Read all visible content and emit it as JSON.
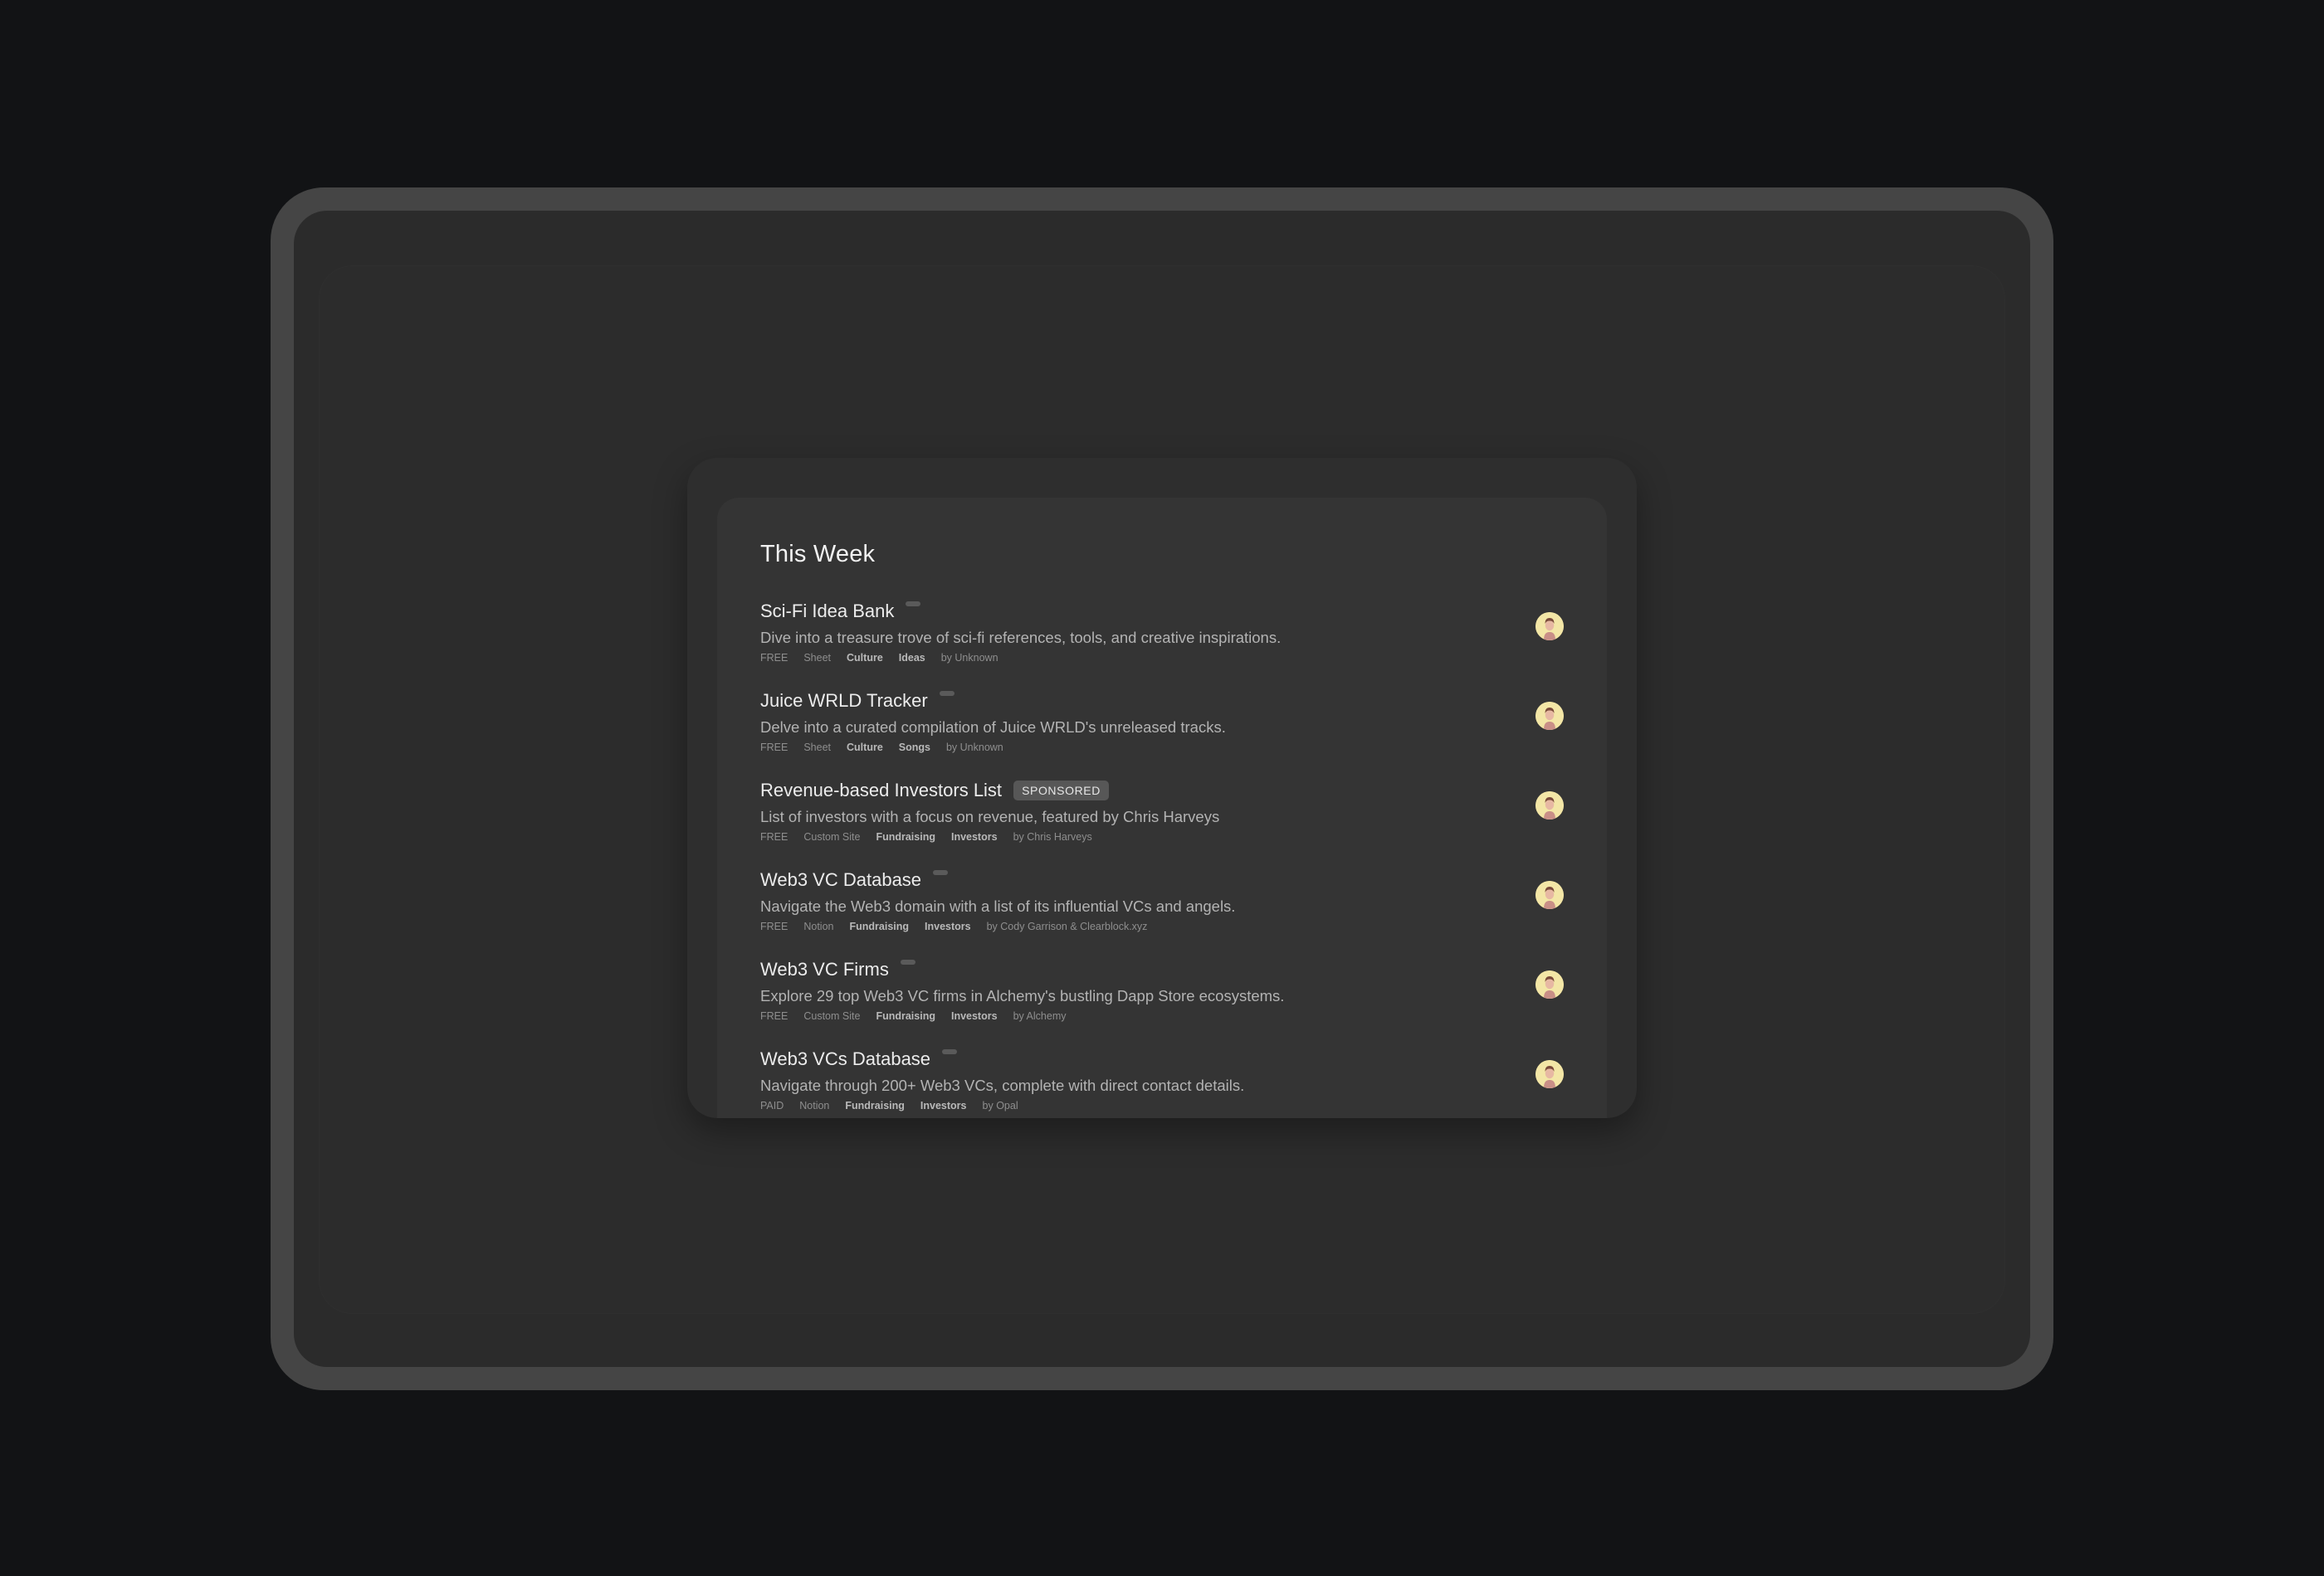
{
  "section": {
    "title": "This Week"
  },
  "items": [
    {
      "title": "Sci-Fi Idea Bank",
      "badge": "",
      "description": "Dive into a treasure trove of sci-fi references, tools, and creative inspirations.",
      "price": "FREE",
      "platform": "Sheet",
      "tags": [
        "Culture",
        "Ideas"
      ],
      "author": "by Unknown"
    },
    {
      "title": "Juice WRLD Tracker",
      "badge": "",
      "description": "Delve into a curated compilation of Juice WRLD's unreleased tracks.",
      "price": "FREE",
      "platform": "Sheet",
      "tags": [
        "Culture",
        "Songs"
      ],
      "author": "by Unknown"
    },
    {
      "title": "Revenue-based Investors List",
      "badge": "SPONSORED",
      "description": "List of investors with a focus on revenue, featured by Chris Harveys",
      "price": "FREE",
      "platform": "Custom Site",
      "tags": [
        "Fundraising",
        "Investors"
      ],
      "author": "by Chris Harveys"
    },
    {
      "title": "Web3 VC Database",
      "badge": "",
      "description": "Navigate the Web3 domain with a list of its influential VCs and angels.",
      "price": "FREE",
      "platform": "Notion",
      "tags": [
        "Fundraising",
        "Investors"
      ],
      "author": "by Cody Garrison & Clearblock.xyz"
    },
    {
      "title": "Web3 VC Firms",
      "badge": "",
      "description": "Explore 29 top Web3 VC firms in Alchemy's bustling Dapp Store ecosystems.",
      "price": "FREE",
      "platform": "Custom Site",
      "tags": [
        "Fundraising",
        "Investors"
      ],
      "author": "by Alchemy"
    },
    {
      "title": "Web3 VCs Database",
      "badge": "",
      "description": "Navigate through 200+ Web3 VCs, complete with direct contact details.",
      "price": "PAID",
      "platform": "Notion",
      "tags": [
        "Fundraising",
        "Investors"
      ],
      "author": "by Opal"
    }
  ],
  "colors": {
    "page_background": "#121315",
    "device_frame": "#454545",
    "screen": "#2b2b2b",
    "card": "#343434",
    "avatar_background": "#f3e6a6",
    "badge_background": "#575757"
  },
  "icons": {
    "avatar": "user-avatar-icon"
  }
}
